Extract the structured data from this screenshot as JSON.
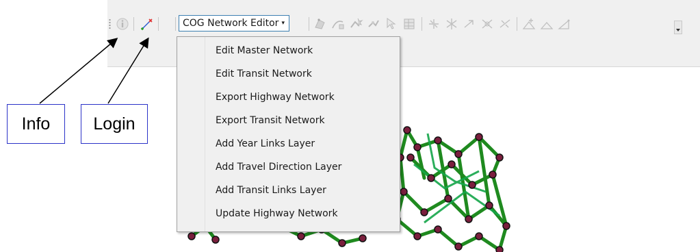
{
  "toolbar": {
    "dropdown_label": "COG Network Editor",
    "icons": [
      "info-icon",
      "login-icon",
      "network-tool-icon"
    ]
  },
  "menu": {
    "items": [
      {
        "label": "Edit Master Network"
      },
      {
        "label": "Edit Transit Network"
      },
      {
        "label": "Export Highway Network"
      },
      {
        "label": "Export Transit Network"
      },
      {
        "label": "Add Year Links Layer"
      },
      {
        "label": "Add Travel Direction Layer"
      },
      {
        "label": "Add Transit Links Layer"
      },
      {
        "label": "Update Highway Network"
      }
    ]
  },
  "callouts": {
    "info_label": "Info",
    "login_label": "Login"
  },
  "colors": {
    "callout_border": "#2a32c8",
    "network_green": "#1f8a1f",
    "node_maroon": "#7a1f3d",
    "highlight_border": "#3c7fb1"
  }
}
